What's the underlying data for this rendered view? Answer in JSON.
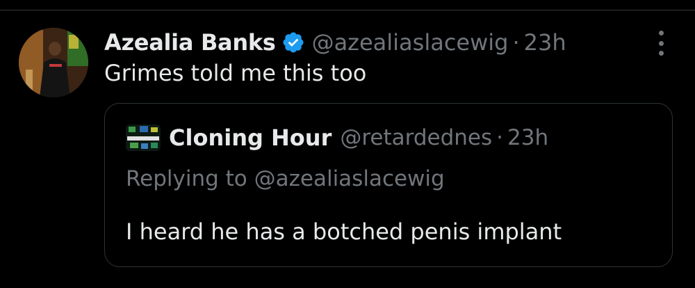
{
  "tweet": {
    "display_name": "Azealia Banks",
    "handle": "@azealiaslacewig",
    "separator": "·",
    "time": "23h",
    "text": "Grimes told me this too",
    "verified": true,
    "badge_color": "#1d9bf0",
    "avatar_icon": "profile-photo",
    "menu_icon": "more-vertical-icon"
  },
  "quote": {
    "display_name": "Cloning Hour",
    "handle": "@retardednes",
    "separator": "·",
    "time": "23h",
    "replying_to": "Replying to @azealiaslacewig",
    "text": "I heard he has a botched penis implant",
    "avatar_icon": "profile-photo"
  },
  "colors": {
    "background": "#000000",
    "primary_text": "#e7e9ea",
    "secondary_text": "#71767b",
    "border": "#2f3336"
  }
}
